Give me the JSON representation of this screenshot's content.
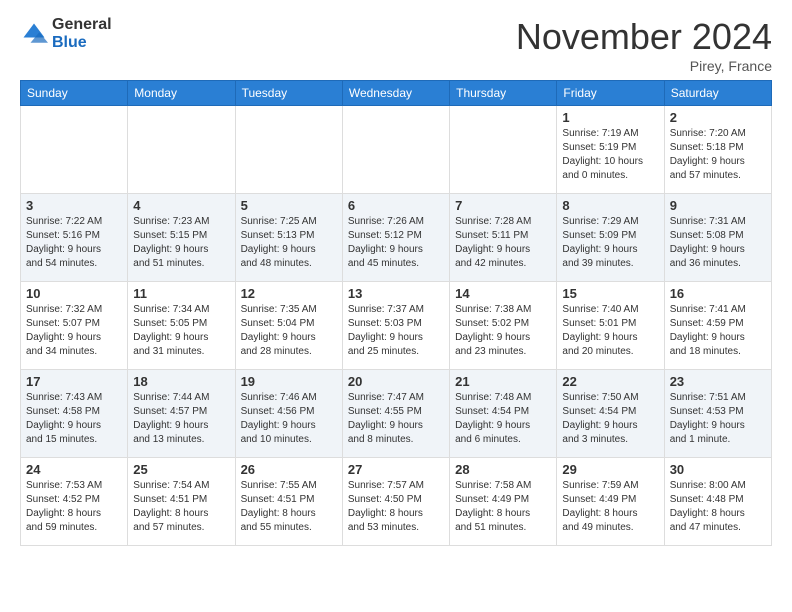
{
  "header": {
    "logo_general": "General",
    "logo_blue": "Blue",
    "title": "November 2024",
    "location": "Pirey, France"
  },
  "days_of_week": [
    "Sunday",
    "Monday",
    "Tuesday",
    "Wednesday",
    "Thursday",
    "Friday",
    "Saturday"
  ],
  "weeks": [
    [
      {
        "day": "",
        "detail": ""
      },
      {
        "day": "",
        "detail": ""
      },
      {
        "day": "",
        "detail": ""
      },
      {
        "day": "",
        "detail": ""
      },
      {
        "day": "",
        "detail": ""
      },
      {
        "day": "1",
        "detail": "Sunrise: 7:19 AM\nSunset: 5:19 PM\nDaylight: 10 hours\nand 0 minutes."
      },
      {
        "day": "2",
        "detail": "Sunrise: 7:20 AM\nSunset: 5:18 PM\nDaylight: 9 hours\nand 57 minutes."
      }
    ],
    [
      {
        "day": "3",
        "detail": "Sunrise: 7:22 AM\nSunset: 5:16 PM\nDaylight: 9 hours\nand 54 minutes."
      },
      {
        "day": "4",
        "detail": "Sunrise: 7:23 AM\nSunset: 5:15 PM\nDaylight: 9 hours\nand 51 minutes."
      },
      {
        "day": "5",
        "detail": "Sunrise: 7:25 AM\nSunset: 5:13 PM\nDaylight: 9 hours\nand 48 minutes."
      },
      {
        "day": "6",
        "detail": "Sunrise: 7:26 AM\nSunset: 5:12 PM\nDaylight: 9 hours\nand 45 minutes."
      },
      {
        "day": "7",
        "detail": "Sunrise: 7:28 AM\nSunset: 5:11 PM\nDaylight: 9 hours\nand 42 minutes."
      },
      {
        "day": "8",
        "detail": "Sunrise: 7:29 AM\nSunset: 5:09 PM\nDaylight: 9 hours\nand 39 minutes."
      },
      {
        "day": "9",
        "detail": "Sunrise: 7:31 AM\nSunset: 5:08 PM\nDaylight: 9 hours\nand 36 minutes."
      }
    ],
    [
      {
        "day": "10",
        "detail": "Sunrise: 7:32 AM\nSunset: 5:07 PM\nDaylight: 9 hours\nand 34 minutes."
      },
      {
        "day": "11",
        "detail": "Sunrise: 7:34 AM\nSunset: 5:05 PM\nDaylight: 9 hours\nand 31 minutes."
      },
      {
        "day": "12",
        "detail": "Sunrise: 7:35 AM\nSunset: 5:04 PM\nDaylight: 9 hours\nand 28 minutes."
      },
      {
        "day": "13",
        "detail": "Sunrise: 7:37 AM\nSunset: 5:03 PM\nDaylight: 9 hours\nand 25 minutes."
      },
      {
        "day": "14",
        "detail": "Sunrise: 7:38 AM\nSunset: 5:02 PM\nDaylight: 9 hours\nand 23 minutes."
      },
      {
        "day": "15",
        "detail": "Sunrise: 7:40 AM\nSunset: 5:01 PM\nDaylight: 9 hours\nand 20 minutes."
      },
      {
        "day": "16",
        "detail": "Sunrise: 7:41 AM\nSunset: 4:59 PM\nDaylight: 9 hours\nand 18 minutes."
      }
    ],
    [
      {
        "day": "17",
        "detail": "Sunrise: 7:43 AM\nSunset: 4:58 PM\nDaylight: 9 hours\nand 15 minutes."
      },
      {
        "day": "18",
        "detail": "Sunrise: 7:44 AM\nSunset: 4:57 PM\nDaylight: 9 hours\nand 13 minutes."
      },
      {
        "day": "19",
        "detail": "Sunrise: 7:46 AM\nSunset: 4:56 PM\nDaylight: 9 hours\nand 10 minutes."
      },
      {
        "day": "20",
        "detail": "Sunrise: 7:47 AM\nSunset: 4:55 PM\nDaylight: 9 hours\nand 8 minutes."
      },
      {
        "day": "21",
        "detail": "Sunrise: 7:48 AM\nSunset: 4:54 PM\nDaylight: 9 hours\nand 6 minutes."
      },
      {
        "day": "22",
        "detail": "Sunrise: 7:50 AM\nSunset: 4:54 PM\nDaylight: 9 hours\nand 3 minutes."
      },
      {
        "day": "23",
        "detail": "Sunrise: 7:51 AM\nSunset: 4:53 PM\nDaylight: 9 hours\nand 1 minute."
      }
    ],
    [
      {
        "day": "24",
        "detail": "Sunrise: 7:53 AM\nSunset: 4:52 PM\nDaylight: 8 hours\nand 59 minutes."
      },
      {
        "day": "25",
        "detail": "Sunrise: 7:54 AM\nSunset: 4:51 PM\nDaylight: 8 hours\nand 57 minutes."
      },
      {
        "day": "26",
        "detail": "Sunrise: 7:55 AM\nSunset: 4:51 PM\nDaylight: 8 hours\nand 55 minutes."
      },
      {
        "day": "27",
        "detail": "Sunrise: 7:57 AM\nSunset: 4:50 PM\nDaylight: 8 hours\nand 53 minutes."
      },
      {
        "day": "28",
        "detail": "Sunrise: 7:58 AM\nSunset: 4:49 PM\nDaylight: 8 hours\nand 51 minutes."
      },
      {
        "day": "29",
        "detail": "Sunrise: 7:59 AM\nSunset: 4:49 PM\nDaylight: 8 hours\nand 49 minutes."
      },
      {
        "day": "30",
        "detail": "Sunrise: 8:00 AM\nSunset: 4:48 PM\nDaylight: 8 hours\nand 47 minutes."
      }
    ]
  ]
}
